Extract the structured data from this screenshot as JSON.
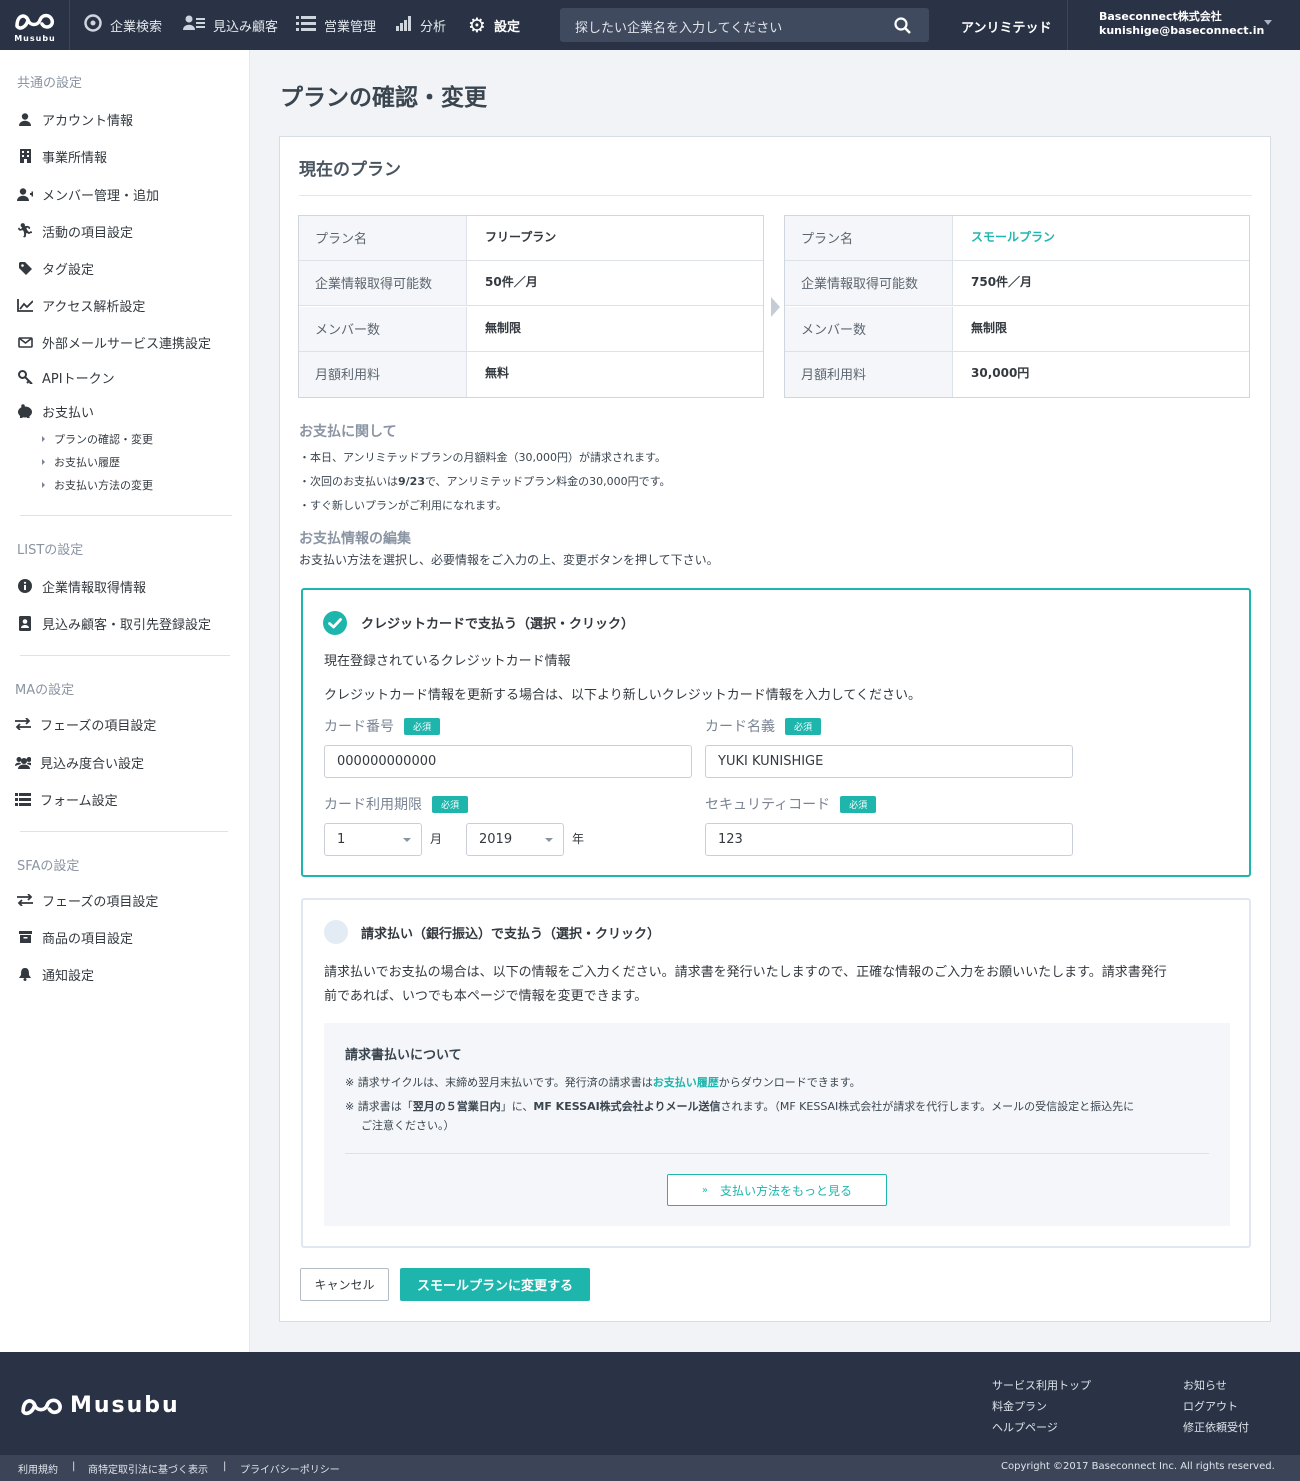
{
  "header": {
    "logo_text": "Musubu",
    "nav": [
      "企業検索",
      "見込み顧客",
      "営業管理",
      "分析",
      "設定"
    ],
    "search_placeholder": "探したい企業名を入力してください",
    "plan": "アンリミテッド",
    "company": "Baseconnect株式会社",
    "email": "kunishige@baseconnect.in"
  },
  "sidebar": {
    "common_heading": "共通の設定",
    "common_items": [
      "アカウント情報",
      "事業所情報",
      "メンバー管理・追加",
      "活動の項目設定",
      "タグ設定",
      "アクセス解析設定",
      "外部メールサービス連携設定",
      "APIトークン",
      "お支払い"
    ],
    "payment_sub": [
      "プランの確認・変更",
      "お支払い履歴",
      "お支払い方法の変更"
    ],
    "list_heading": "LISTの設定",
    "list_items": [
      "企業情報取得情報",
      "見込み顧客・取引先登録設定"
    ],
    "ma_heading": "MAの設定",
    "ma_items": [
      "フェーズの項目設定",
      "見込み度合い設定",
      "フォーム設定"
    ],
    "sfa_heading": "SFAの設定",
    "sfa_items": [
      "フェーズの項目設定",
      "商品の項目設定",
      "通知設定"
    ]
  },
  "page": {
    "title": "プランの確認・変更",
    "current_plan": "現在のプラン",
    "table_keys": [
      "プラン名",
      "企業情報取得可能数",
      "メンバー数",
      "月額利用料"
    ],
    "old_plan": [
      "フリープラン",
      "50件／月",
      "無制限",
      "無料"
    ],
    "new_plan": [
      "スモールプラン",
      "750件／月",
      "無制限",
      "30,000円"
    ],
    "payment_heading": "お支払に関して",
    "payment_notes": [
      "・本日、アンリミテッドプランの月額料金（30,000円）が請求されます。",
      "・次回のお支払いは",
      "9/23",
      "で、アンリミテッドプラン料金の30,000円です。",
      "・すぐ新しいプランがご利用になれます。"
    ],
    "edit_heading": "お支払情報の編集",
    "edit_desc": "お支払い方法を選択し、必要情報をご入力の上、変更ボタンを押して下さい。"
  },
  "credit": {
    "title": "クレジットカードで支払う（選択・クリック）",
    "registered": "現在登録されているクレジットカード情報",
    "update_note": "クレジットカード情報を更新する場合は、以下より新しいクレジットカード情報を入力してください。",
    "required": "必須",
    "card_number_label": "カード番号",
    "card_number": "000000000000",
    "card_name_label": "カード名義",
    "card_name": "YUKI KUNISHIGE",
    "expiry_label": "カード利用期限",
    "month": "1",
    "month_unit": "月",
    "year": "2019",
    "year_unit": "年",
    "security_label": "セキュリティコード",
    "security": "123"
  },
  "invoice": {
    "title": "請求払い（銀行振込）で支払う（選択・クリック）",
    "desc1": "請求払いでお支払の場合は、以下の情報をご入力ください。請求書を発行いたしますので、正確な情報のご入力をお願いいたします。請求書発行",
    "desc2": "前であれば、いつでも本ページで情報を変更できます。",
    "about_title": "請求書払いについて",
    "note1a": "※ 請求サイクルは、末締め翌月末払いです。発行済の請求書は",
    "note1_link": "お支払い履歴",
    "note1b": "からダウンロードできます。",
    "note2a": "※ 請求書は「",
    "note2b": "翌月の５営業日内",
    "note2c": "」に、",
    "note2d": "MF KESSAI株式会社よりメール送信",
    "note2e": "されます。（MF KESSAI株式会社が請求を代行します。メールの受信設定と振込先に",
    "note2f": "ご注意ください。）",
    "more": "支払い方法をもっと見る"
  },
  "actions": {
    "cancel": "キャンセル",
    "confirm": "スモールプランに変更する"
  },
  "footer": {
    "logo": "Musubu",
    "links_left": [
      "サービス利用トップ",
      "料金プラン",
      "ヘルプページ"
    ],
    "links_right": [
      "お知らせ",
      "ログアウト",
      "修正依頼受付"
    ],
    "bottom_links": [
      "利用規約",
      "|",
      "商特定取引法に基づく表示",
      "|",
      "プライバシーポリシー"
    ],
    "copyright": "Copyright ©2017 Baseconnect Inc. All rights reserved."
  },
  "colors": {
    "accent": "#1eb5ac",
    "header": "#2a3345"
  }
}
